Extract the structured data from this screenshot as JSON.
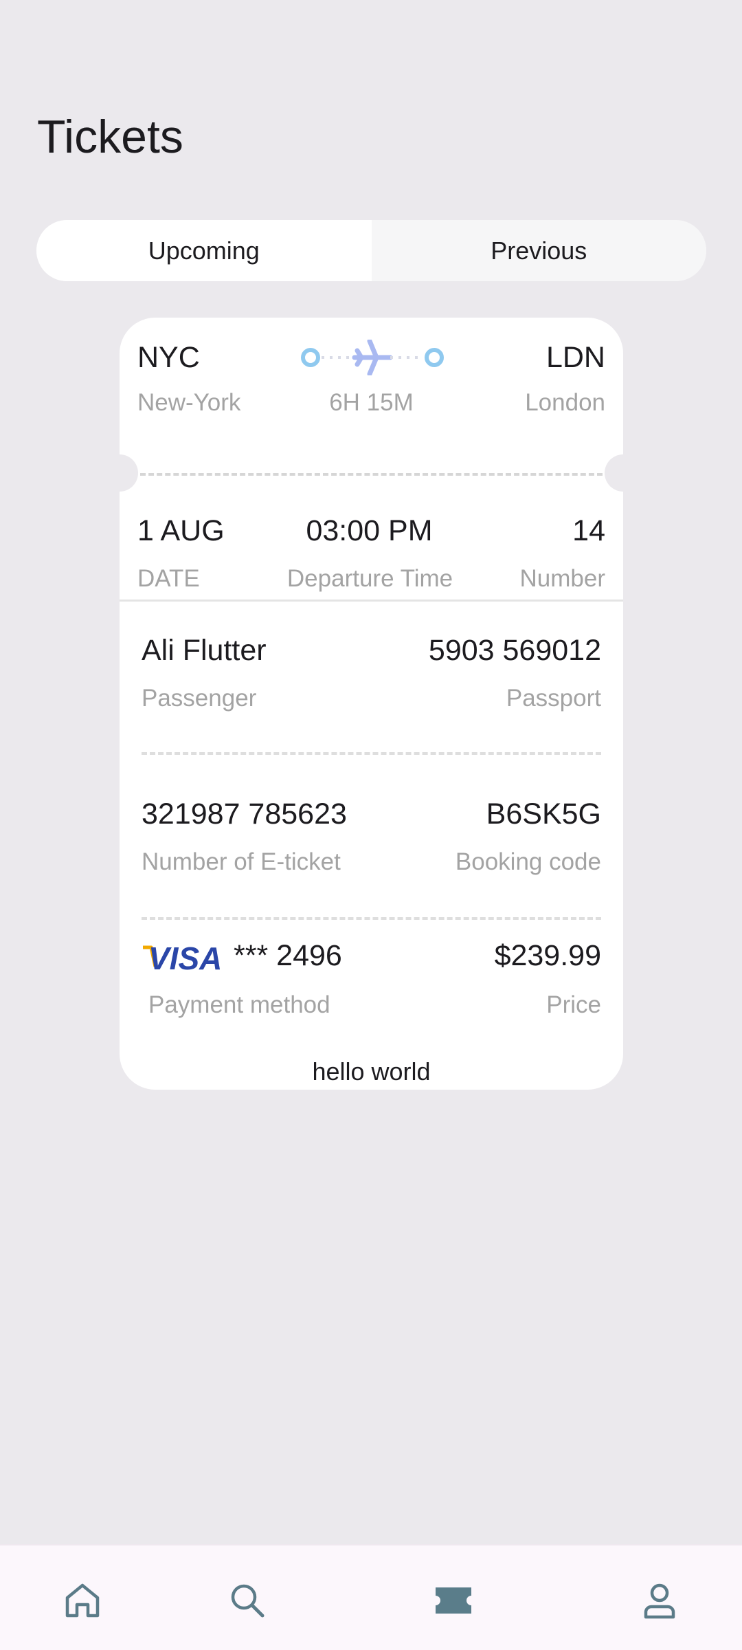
{
  "header": {
    "title": "Tickets"
  },
  "tabs": [
    {
      "label": "Upcoming",
      "active": true
    },
    {
      "label": "Previous",
      "active": false
    }
  ],
  "ticket": {
    "route": {
      "from_code": "NYC",
      "from_city": "New-York",
      "to_code": "LDN",
      "to_city": "London",
      "duration": "6H 15M"
    },
    "details": {
      "date": "1 AUG",
      "date_label": "DATE",
      "time": "03:00 PM",
      "time_label": "Departure Time",
      "number": "14",
      "number_label": "Number"
    },
    "passenger": {
      "name": "Ali Flutter",
      "name_label": "Passenger",
      "passport": "5903 569012",
      "passport_label": "Passport"
    },
    "booking": {
      "eticket": "321987 785623",
      "eticket_label": "Number of E-ticket",
      "code": "B6SK5G",
      "code_label": "Booking code"
    },
    "payment": {
      "card_brand": "VISA",
      "card": "*** 2496",
      "method_label": "Payment method",
      "price": "$239.99",
      "price_label": "Price"
    },
    "footer_text": "hello world"
  },
  "colors": {
    "background": "#ebe9ed",
    "card": "#ffffff",
    "muted_text": "#a3a3a3",
    "route_dot": "#8fc9ef",
    "plane": "#a9b9f1",
    "nav_active": "#5a7d8a",
    "nav_inactive": "#5b7b88"
  },
  "nav": [
    {
      "icon": "home-icon",
      "active": false
    },
    {
      "icon": "search-icon",
      "active": false
    },
    {
      "icon": "ticket-icon",
      "active": true
    },
    {
      "icon": "profile-icon",
      "active": false
    }
  ]
}
